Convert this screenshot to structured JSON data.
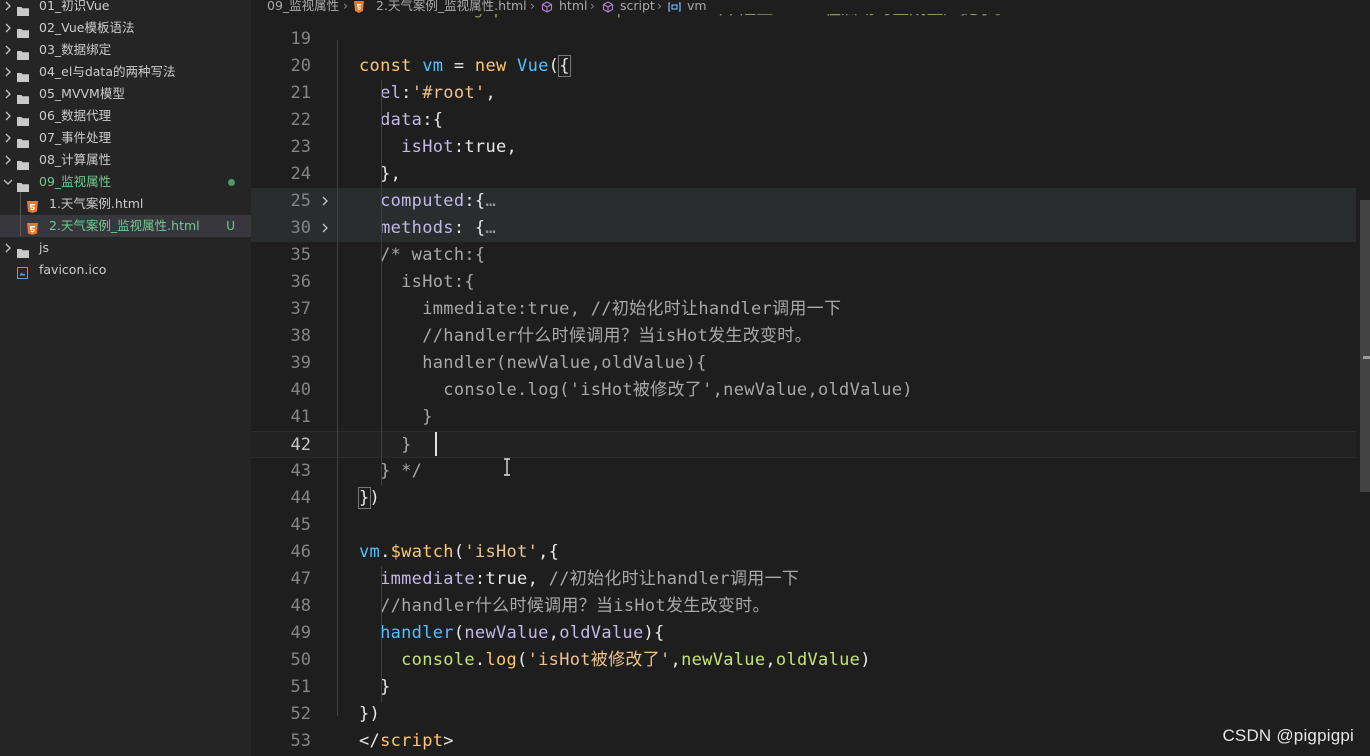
{
  "sidebar": {
    "items": [
      {
        "label": "01_初识Vue",
        "type": "folder",
        "state": "collapsed"
      },
      {
        "label": "02_Vue模板语法",
        "type": "folder",
        "state": "collapsed"
      },
      {
        "label": "03_数据绑定",
        "type": "folder",
        "state": "collapsed"
      },
      {
        "label": "04_el与data的两种写法",
        "type": "folder",
        "state": "collapsed"
      },
      {
        "label": "05_MVVM模型",
        "type": "folder",
        "state": "collapsed"
      },
      {
        "label": "06_数据代理",
        "type": "folder",
        "state": "collapsed"
      },
      {
        "label": "07_事件处理",
        "type": "folder",
        "state": "collapsed"
      },
      {
        "label": "08_计算属性",
        "type": "folder",
        "state": "collapsed"
      },
      {
        "label": "09_监视属性",
        "type": "folder",
        "state": "expanded",
        "git": "modified-dot"
      },
      {
        "label": "1.天气案例.html",
        "type": "html-file"
      },
      {
        "label": "2.天气案例_监视属性.html",
        "type": "html-file",
        "badge": "U",
        "selected": true
      },
      {
        "label": "js",
        "type": "folder",
        "state": "collapsed"
      },
      {
        "label": "favicon.ico",
        "type": "ico-file"
      }
    ]
  },
  "breadcrumb": {
    "folder": "09_监视属性",
    "file": "2.天气案例_监视属性.html",
    "html": "html",
    "script": "script",
    "vm": "vm"
  },
  "editor": {
    "ghost_line": "Vue.config.productionTip = false //阻止 vue 在启动时生成生产提示。",
    "active_line": "42",
    "lines": [
      {
        "n": "19",
        "tokens": []
      },
      {
        "n": "20",
        "tokens": [
          [
            "kw",
            "const "
          ],
          [
            "var",
            "vm"
          ],
          [
            "plain",
            " = "
          ],
          [
            "kw",
            "new "
          ],
          [
            "var",
            "Vue"
          ],
          [
            "plain",
            "("
          ],
          [
            "box",
            "{"
          ]
        ]
      },
      {
        "n": "21",
        "tokens": [
          [
            "prop",
            "  el"
          ],
          [
            "plain",
            ":"
          ],
          [
            "str",
            "'#root'"
          ],
          [
            "plain",
            ","
          ]
        ]
      },
      {
        "n": "22",
        "tokens": [
          [
            "prop",
            "  data"
          ],
          [
            "plain",
            ":{"
          ]
        ]
      },
      {
        "n": "23",
        "tokens": [
          [
            "prop",
            "    isHot"
          ],
          [
            "plain",
            ":"
          ],
          [
            "bool",
            "true"
          ],
          [
            "plain",
            ","
          ]
        ]
      },
      {
        "n": "24",
        "tokens": [
          [
            "plain",
            "  },"
          ]
        ]
      },
      {
        "n": "25",
        "tokens": [
          [
            "prop",
            "  computed"
          ],
          [
            "plain",
            ":{"
          ],
          [
            "ellipsis",
            "…"
          ]
        ],
        "fold": true
      },
      {
        "n": "30",
        "tokens": [
          [
            "prop",
            "  methods"
          ],
          [
            "plain",
            ": {"
          ],
          [
            "ellipsis",
            "…"
          ]
        ],
        "fold": true
      },
      {
        "n": "35",
        "tokens": [
          [
            "comment",
            "  /* watch:{"
          ]
        ]
      },
      {
        "n": "36",
        "tokens": [
          [
            "comment",
            "    isHot:{"
          ]
        ]
      },
      {
        "n": "37",
        "tokens": [
          [
            "comment",
            "      immediate:true, //初始化时让handler调用一下"
          ]
        ]
      },
      {
        "n": "38",
        "tokens": [
          [
            "comment",
            "      //handler什么时候调用？当isHot发生改变时。"
          ]
        ]
      },
      {
        "n": "39",
        "tokens": [
          [
            "comment",
            "      handler(newValue,oldValue){"
          ]
        ]
      },
      {
        "n": "40",
        "tokens": [
          [
            "comment",
            "        console.log('isHot被修改了',newValue,oldValue)"
          ]
        ]
      },
      {
        "n": "41",
        "tokens": [
          [
            "comment",
            "      }"
          ]
        ]
      },
      {
        "n": "42",
        "tokens": [
          [
            "comment",
            "    }"
          ]
        ]
      },
      {
        "n": "43",
        "tokens": [
          [
            "comment",
            "  } */"
          ]
        ]
      },
      {
        "n": "44",
        "tokens": [
          [
            "box",
            "}"
          ],
          [
            "plain",
            ")"
          ]
        ]
      },
      {
        "n": "45",
        "tokens": []
      },
      {
        "n": "46",
        "tokens": [
          [
            "var",
            "vm"
          ],
          [
            "plain",
            "."
          ],
          [
            "kw",
            "$watch"
          ],
          [
            "plain",
            "("
          ],
          [
            "str",
            "'isHot'"
          ],
          [
            "plain",
            ",{"
          ]
        ]
      },
      {
        "n": "47",
        "tokens": [
          [
            "prop",
            "  immediate"
          ],
          [
            "plain",
            ":"
          ],
          [
            "bool",
            "true"
          ],
          [
            "plain",
            ", "
          ],
          [
            "comment",
            "//初始化时让handler调用一下"
          ]
        ]
      },
      {
        "n": "48",
        "tokens": [
          [
            "comment",
            "  //handler什么时候调用？当isHot发生改变时。"
          ]
        ]
      },
      {
        "n": "49",
        "tokens": [
          [
            "var",
            "  handler"
          ],
          [
            "plain",
            "("
          ],
          [
            "prop",
            "newValue"
          ],
          [
            "plain",
            ","
          ],
          [
            "prop",
            "oldValue"
          ],
          [
            "plain",
            "){"
          ]
        ]
      },
      {
        "n": "50",
        "tokens": [
          [
            "green",
            "    console"
          ],
          [
            "plain",
            "."
          ],
          [
            "kw",
            "log"
          ],
          [
            "plain",
            "("
          ],
          [
            "str",
            "'isHot被修改了'"
          ],
          [
            "plain",
            ","
          ],
          [
            "green",
            "newValue"
          ],
          [
            "plain",
            ","
          ],
          [
            "green",
            "oldValue"
          ],
          [
            "plain",
            ")"
          ]
        ]
      },
      {
        "n": "51",
        "tokens": [
          [
            "plain",
            "  }"
          ]
        ]
      },
      {
        "n": "52",
        "tokens": [
          [
            "plain",
            "})"
          ]
        ]
      },
      {
        "n": "53",
        "tokens": [
          [
            "tag",
            "</"
          ],
          [
            "kw",
            "script"
          ],
          [
            "tag",
            ">"
          ]
        ]
      }
    ]
  },
  "watermark": "CSDN @pigpigpi",
  "colors": {
    "sidebar_bg": "#252526",
    "editor_bg": "#1e1e1e",
    "git_untracked": "#73c991",
    "keyword": "#ffc66d",
    "variable": "#4fc1ff",
    "property": "#c3b8e6",
    "string": "#ecc48d",
    "comment": "#a8a8a8"
  }
}
